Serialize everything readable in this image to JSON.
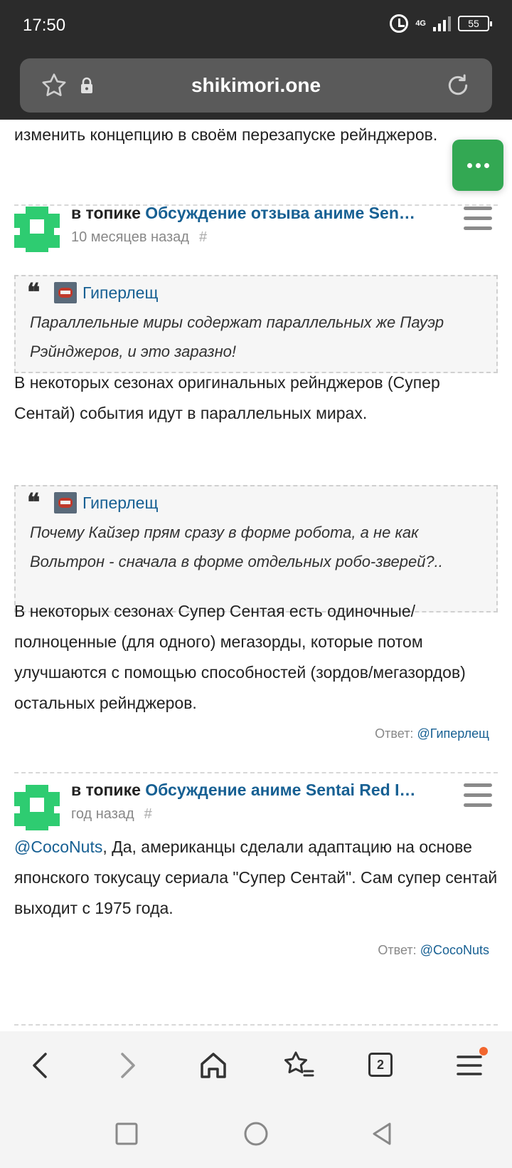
{
  "status": {
    "time": "17:50",
    "network": "4G",
    "battery": "55"
  },
  "browser": {
    "url": "shikimori.one"
  },
  "content": {
    "intro_text": "изменить концепцию в своём перезапуске рейнджеров.",
    "comments": [
      {
        "topic_prefix": "в топике",
        "topic_title": "Обсуждение отзыва аниме Sen…",
        "time": "10 месяцев назад",
        "hash": "#",
        "quotes": [
          {
            "user": "Гиперлещ",
            "text": "Параллельные миры содержат параллельных же Пауэр Рэйнджеров, и это заразно!"
          },
          {
            "user": "Гиперлещ",
            "text": "Почему Кайзер прям сразу в форме робота, а не как Вольтрон - сначала в форме отдельных робо-зверей?.."
          }
        ],
        "body_1": "В некоторых сезонах оригинальных рейнджеров (Супер Сентай) события идут в параллельных мирах.",
        "body_2": "В некоторых сезонах Супер Сентая есть одиночные/полноценные (для одного) мегазорды, которые потом улучшаются с помощью способностей (зордов/мегазордов) остальных рейнджеров.",
        "reply_label": "Ответ:",
        "reply_user": "@Гиперлещ"
      },
      {
        "topic_prefix": "в топике",
        "topic_title": "Обсуждение аниме Sentai Red I…",
        "time": "год назад",
        "hash": "#",
        "mention": "@CocoNuts",
        "body": ", Да, американцы сделали адаптацию на основе японского токусацу сериала \"Супер Сентай\". Сам супер сентай выходит с 1975 года.",
        "reply_label": "Ответ:",
        "reply_user": "@CocoNuts"
      }
    ]
  },
  "bottom_bar": {
    "tabs_count": "2"
  },
  "colors": {
    "link": "#176093",
    "accent_green": "#33a853",
    "avatar_green": "#2ecc71",
    "status_bg": "#2b2b2b"
  }
}
